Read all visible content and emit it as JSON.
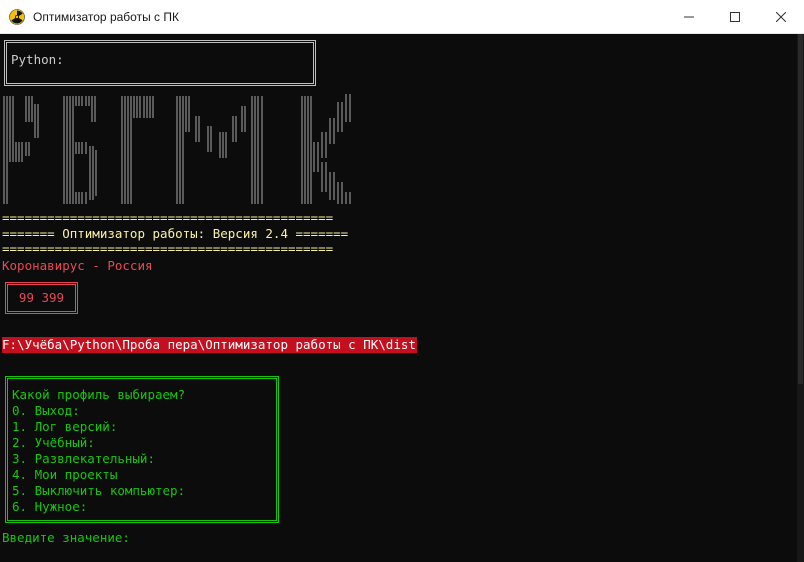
{
  "window": {
    "title": "Оптимизатор работы с ПК",
    "app_icon": "radiation-icon",
    "controls": [
      "minimize-icon",
      "maximize-icon",
      "close-icon"
    ]
  },
  "console": {
    "python_prompt": "Python:",
    "banner_art_text": "РБГМК",
    "separator": "============================================",
    "header": "======= Оптимизатор работы: Версия 2.4 =======",
    "corona_label": "Коронавирус - Россия",
    "corona_count": "99 399",
    "path": "F:\\Учёба\\Python\\Проба пера\\Оптимизатор работы с ПК\\dist",
    "menu": {
      "question": "Какой профиль выбираем?",
      "items": [
        "0. Выход:",
        "1. Лог версий:",
        "2. Учёбный:",
        "3. Развлекательный:",
        "4. Мои проекты",
        "5. Выключить компьютер:",
        "6. Нужное:"
      ]
    },
    "input_prompt": "Введите значение:"
  },
  "colors": {
    "background": "#0c0c0c",
    "yellow": "#f9f1a5",
    "red": "#e74856",
    "green": "#16c60c",
    "path_highlight": "#c50f1f"
  }
}
